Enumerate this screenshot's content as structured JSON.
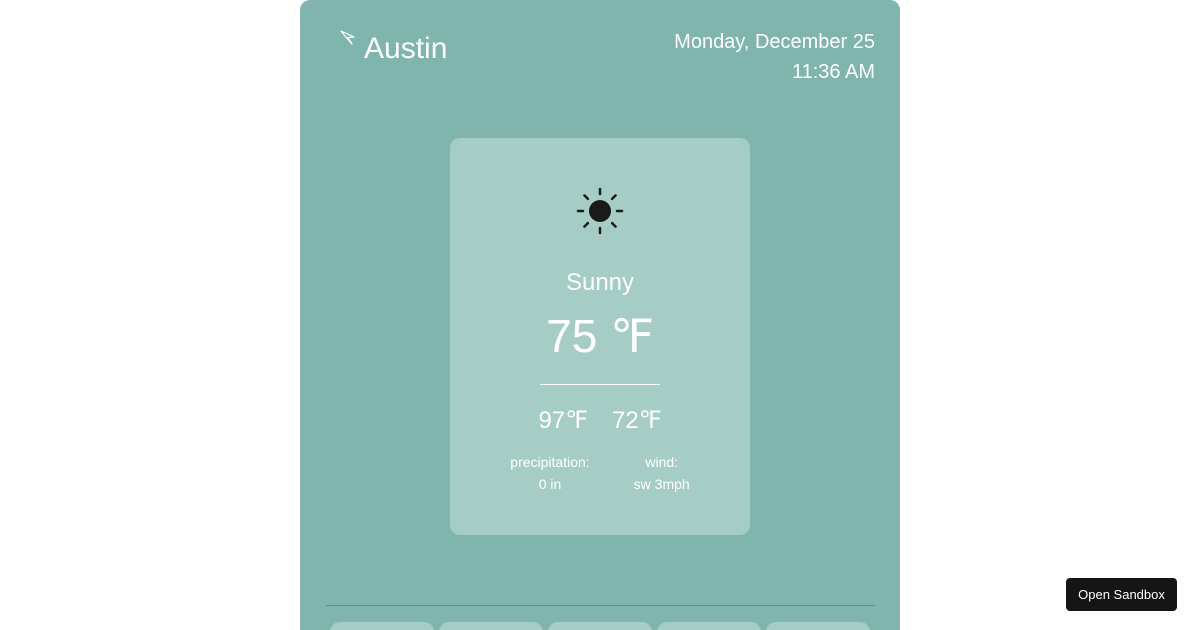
{
  "header": {
    "city": "Austin",
    "date": "Monday, December 25",
    "time": "11:36 AM"
  },
  "current": {
    "condition": "Sunny",
    "temperature": "75 ℉",
    "high": "97℉",
    "low": "72℉",
    "precipitation_label": "precipitation:",
    "precipitation_value": "0 in",
    "wind_label": "wind:",
    "wind_value": "sw 3mph"
  },
  "icons": {
    "location": "navigation-arrow-icon",
    "weather": "sun-icon"
  },
  "colors": {
    "app_background": "#7fb5ac",
    "card_background": "#a6cdc5",
    "sandbox_button": "#151515"
  },
  "sandbox_button": {
    "label": "Open Sandbox"
  }
}
